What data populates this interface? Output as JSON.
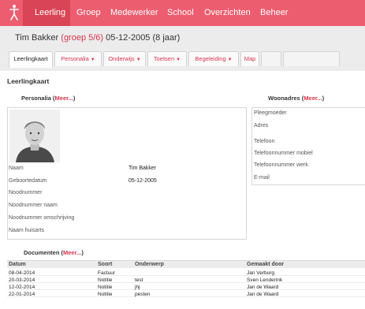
{
  "nav": {
    "items": [
      "Leerling",
      "Groep",
      "Medewerker",
      "School",
      "Overzichten",
      "Beheer"
    ],
    "active": "Leerling",
    "accent": "#ec5d6f",
    "logo_icon": "stick-figure-icon"
  },
  "student": {
    "name": "Tim Bakker",
    "group": "(groep 5/6)",
    "dob_age": "05-12-2005 (8 jaar)"
  },
  "tabs": [
    {
      "label": "Leerlingkaart",
      "dropdown": false
    },
    {
      "label": "Personalia",
      "dropdown": true
    },
    {
      "label": "Onderwijs",
      "dropdown": true
    },
    {
      "label": "Toetsen",
      "dropdown": true
    },
    {
      "label": "Begeleiding",
      "dropdown": true
    },
    {
      "label": "Map",
      "dropdown": false
    }
  ],
  "section_title": "Leerlingkaart",
  "meer": "Meer...",
  "personalia": {
    "title": "Personalia",
    "fields": [
      {
        "label": "Naam",
        "value": "Tim Bakker"
      },
      {
        "label": "Geboortedatum",
        "value": "05-12-2005"
      },
      {
        "label": "Noodnummer",
        "value": ""
      },
      {
        "label": "Noodnummer naam",
        "value": ""
      },
      {
        "label": "Noodnummer omschrijving",
        "value": ""
      },
      {
        "label": "Naam huisarts",
        "value": ""
      }
    ]
  },
  "woonadres": {
    "title": "Woonadres",
    "fields": [
      "Pleegmoeder",
      "Adres",
      "Telefoon",
      "Telefoonnummer mobiel",
      "Telefoonnummer werk",
      "E-mail"
    ]
  },
  "documenten": {
    "title": "Documenten",
    "columns": [
      "Datum",
      "Soort",
      "Onderwerp",
      "Gemaakt door"
    ],
    "rows": [
      [
        "08-04-2014",
        "Factuur",
        "",
        "Jan Verburg"
      ],
      [
        "20-03-2014",
        "Notitie",
        "test",
        "Sven Lenderink"
      ],
      [
        "12-02-2014",
        "Notitie",
        "jhj",
        "Jan de Waard"
      ],
      [
        "22-01-2014",
        "Notitie",
        "pesten",
        "Jan de Waard"
      ]
    ]
  }
}
